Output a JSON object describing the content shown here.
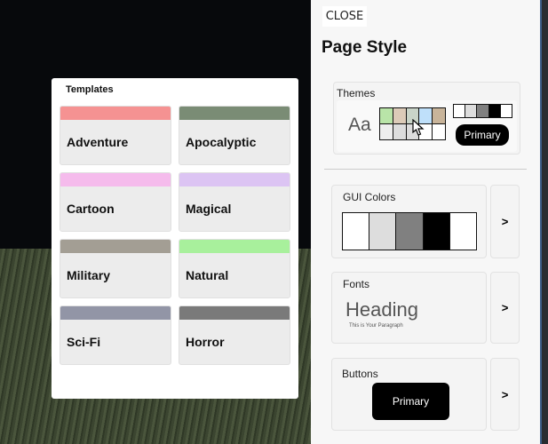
{
  "templates": {
    "title": "Templates",
    "items": [
      {
        "label": "Adventure",
        "color": "#f59292"
      },
      {
        "label": "Apocalyptic",
        "color": "#7a8c75"
      },
      {
        "label": "Cartoon",
        "color": "#f5bbec"
      },
      {
        "label": "Magical",
        "color": "#dcc4f3"
      },
      {
        "label": "Military",
        "color": "#a39e94"
      },
      {
        "label": "Natural",
        "color": "#a8f09c"
      },
      {
        "label": "Sci-Fi",
        "color": "#9295a6"
      },
      {
        "label": "Horror",
        "color": "#7a7a7a"
      }
    ]
  },
  "panel": {
    "close_label": "CLOSE",
    "title": "Page Style",
    "themes": {
      "label": "Themes",
      "font_preview": "Aa",
      "button_label": "Primary",
      "row1": [
        "#b9e4a8",
        "#dccbb8",
        "#c9d4c8",
        "#bfe0fa",
        "#c8b49a"
      ],
      "row2": [
        "#eeeeee",
        "#dddddd",
        "#dddddd",
        "#ffffff",
        "#ffffff"
      ],
      "gui": [
        "#ffffff",
        "#dddddd",
        "#808080",
        "#000000",
        "#ffffff"
      ]
    },
    "gui_colors": {
      "label": "GUI Colors",
      "colors": [
        "#ffffff",
        "#dddddd",
        "#808080",
        "#000000",
        "#ffffff"
      ],
      "arrow": ">"
    },
    "fonts": {
      "label": "Fonts",
      "heading": "Heading",
      "paragraph": "This is Your Paragraph",
      "arrow": ">"
    },
    "buttons": {
      "label": "Buttons",
      "button_label": "Primary",
      "arrow": ">"
    }
  }
}
